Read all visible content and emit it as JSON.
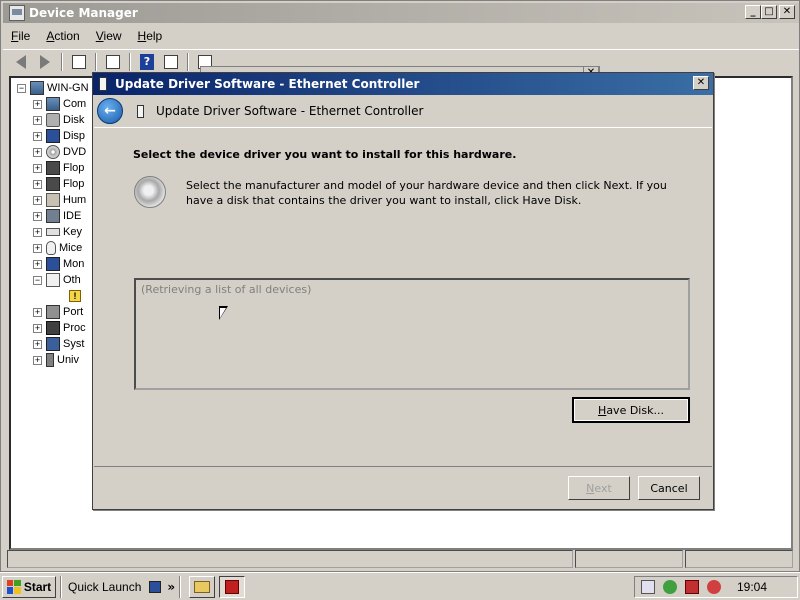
{
  "main_window": {
    "title": "Device Manager",
    "controls": {
      "minimize": "_",
      "maximize": "□",
      "close": "✕"
    },
    "menu": [
      {
        "accel": "F",
        "rest": "ile"
      },
      {
        "accel": "A",
        "rest": "ction"
      },
      {
        "accel": "V",
        "rest": "iew"
      },
      {
        "accel": "H",
        "rest": "elp"
      }
    ],
    "tree": {
      "root": "WIN-GN",
      "items": [
        {
          "label": "Com",
          "icon": "computer-icon"
        },
        {
          "label": "Disk",
          "icon": "disk-icon"
        },
        {
          "label": "Disp",
          "icon": "display-icon"
        },
        {
          "label": "DVD",
          "icon": "dvd-icon"
        },
        {
          "label": "Flop",
          "icon": "floppy-controller-icon"
        },
        {
          "label": "Flop",
          "icon": "floppy-drive-icon"
        },
        {
          "label": "Hum",
          "icon": "hid-icon"
        },
        {
          "label": "IDE",
          "icon": "ide-icon"
        },
        {
          "label": "Key",
          "icon": "keyboard-icon"
        },
        {
          "label": "Mice",
          "icon": "mouse-icon"
        },
        {
          "label": "Mon",
          "icon": "monitor-icon"
        },
        {
          "label": "Oth",
          "icon": "other-devices-icon"
        },
        {
          "label": "Port",
          "icon": "port-icon"
        },
        {
          "label": "Proc",
          "icon": "processor-icon"
        },
        {
          "label": "Syst",
          "icon": "system-icon"
        },
        {
          "label": "Univ",
          "icon": "usb-icon"
        }
      ],
      "collapsed_symbol": "+",
      "expanded_symbol": "−",
      "warning_symbol": "!"
    }
  },
  "dialog": {
    "title": "Update Driver Software - Ethernet Controller",
    "header": "Update Driver Software - Ethernet Controller",
    "back_symbol": "←",
    "close_symbol": "✕",
    "instruction": "Select the device driver you want to install for this hardware.",
    "description": "Select the manufacturer and model of your hardware device and then click Next. If you have a disk that contains the driver you want to install, click Have Disk.",
    "list_placeholder": "(Retrieving a list of all devices)",
    "have_disk": {
      "accel": "H",
      "rest": "ave Disk..."
    },
    "next": {
      "accel": "N",
      "rest": "ext"
    },
    "cancel": "Cancel"
  },
  "taskbar": {
    "start": "Start",
    "quick_launch": "Quick Launch",
    "chevron": "»",
    "clock": "19:04"
  }
}
